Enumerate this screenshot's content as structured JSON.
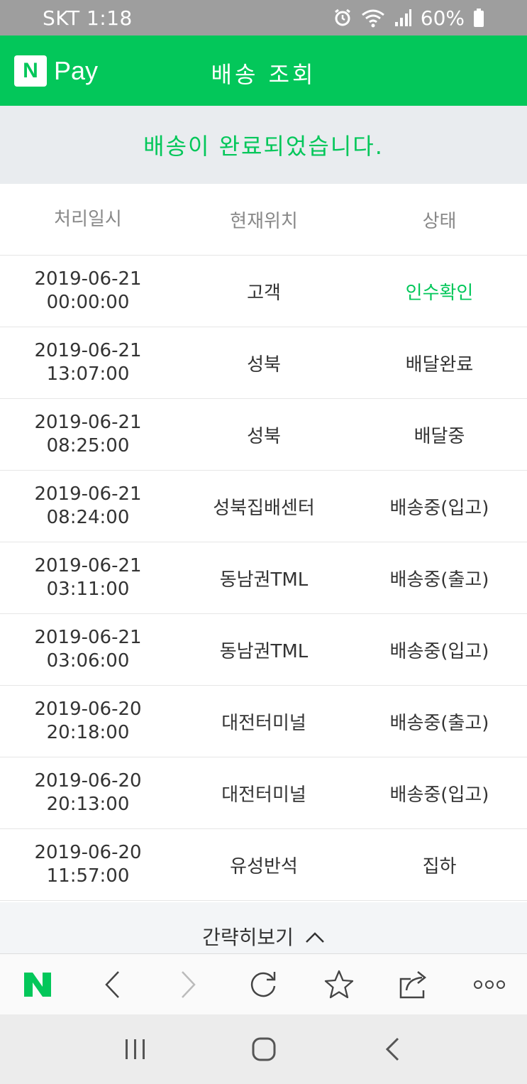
{
  "status_bar": {
    "carrier_time": "SKT 1:18",
    "battery": "60%"
  },
  "header": {
    "logo_letter": "N",
    "logo_text": "Pay",
    "title": "배송 조회"
  },
  "banner": {
    "message": "배송이 완료되었습니다."
  },
  "table": {
    "headers": [
      "처리일시",
      "현재위치",
      "상태"
    ],
    "rows": [
      {
        "date": "2019-06-21",
        "time": "00:00:00",
        "location": "고객",
        "status": "인수확인"
      },
      {
        "date": "2019-06-21",
        "time": "13:07:00",
        "location": "성북",
        "status": "배달완료"
      },
      {
        "date": "2019-06-21",
        "time": "08:25:00",
        "location": "성북",
        "status": "배달중"
      },
      {
        "date": "2019-06-21",
        "time": "08:24:00",
        "location": "성북집배센터",
        "status": "배송중(입고)"
      },
      {
        "date": "2019-06-21",
        "time": "03:11:00",
        "location": "동남권TML",
        "status": "배송중(출고)"
      },
      {
        "date": "2019-06-21",
        "time": "03:06:00",
        "location": "동남권TML",
        "status": "배송중(입고)"
      },
      {
        "date": "2019-06-20",
        "time": "20:18:00",
        "location": "대전터미널",
        "status": "배송중(출고)"
      },
      {
        "date": "2019-06-20",
        "time": "20:13:00",
        "location": "대전터미널",
        "status": "배송중(입고)"
      },
      {
        "date": "2019-06-20",
        "time": "11:57:00",
        "location": "유성반석",
        "status": "집하"
      }
    ]
  },
  "collapse": {
    "label": "간략히보기"
  },
  "colors": {
    "brand_green": "#03c75a",
    "banner_bg": "#e9ecef",
    "status_bar_bg": "#9e9e9e"
  }
}
